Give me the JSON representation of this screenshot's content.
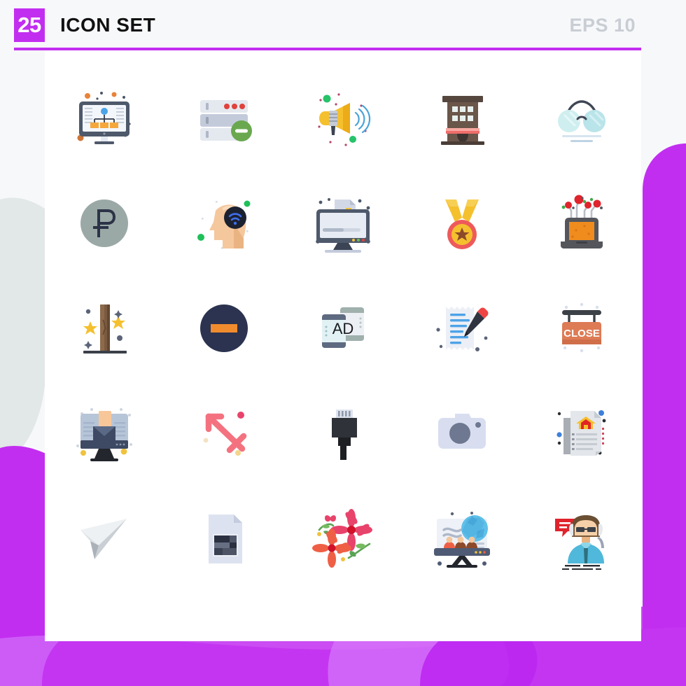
{
  "header": {
    "count": "25",
    "title": "ICON SET",
    "format": "EPS 10",
    "badge_color": "#c22ef0",
    "rule_color": "#c22ef0",
    "title_color": "#111111",
    "format_color": "#c9cdd4"
  },
  "background": {
    "page_color": "#f7f8fa",
    "card_color": "#ffffff",
    "blob_gray": "#e2e7e8",
    "blob_magenta": "#c22ef0",
    "blob_magenta_light": "#cd5cf7"
  },
  "grid": {
    "columns": 5,
    "rows": 5,
    "total_icons": 25
  },
  "icons": [
    {
      "index": 1,
      "name": "monitor-network-diagram-icon",
      "label": "Monitor Network Diagram"
    },
    {
      "index": 2,
      "name": "server-remove-icon",
      "label": "Server Remove"
    },
    {
      "index": 3,
      "name": "megaphone-icon",
      "label": "Megaphone Announcement"
    },
    {
      "index": 4,
      "name": "shop-building-icon",
      "label": "Shop Building"
    },
    {
      "index": 5,
      "name": "eyeglasses-icon",
      "label": "Eyeglasses"
    },
    {
      "index": 6,
      "name": "ruble-coin-icon",
      "label": "Ruble Coin"
    },
    {
      "index": 7,
      "name": "head-wifi-brain-icon",
      "label": "Head Wifi Brain"
    },
    {
      "index": 8,
      "name": "monitor-document-upload-icon",
      "label": "Monitor Document Upload"
    },
    {
      "index": 9,
      "name": "medal-star-icon",
      "label": "Medal Star Award"
    },
    {
      "index": 10,
      "name": "laptop-network-nodes-icon",
      "label": "Laptop Network Nodes"
    },
    {
      "index": 11,
      "name": "wooden-post-stars-icon",
      "label": "Wooden Post With Stars"
    },
    {
      "index": 12,
      "name": "circle-minus-remove-icon",
      "label": "Circle Minus Remove"
    },
    {
      "index": 13,
      "name": "mobile-ad-icon",
      "label": "Mobile Advertising"
    },
    {
      "index": 14,
      "name": "note-pencil-edit-icon",
      "label": "Note Pencil Edit"
    },
    {
      "index": 15,
      "name": "close-sign-icon",
      "label": "Close Sign",
      "sign_text": "CLOSE"
    },
    {
      "index": 16,
      "name": "monitor-email-icon",
      "label": "Monitor Email"
    },
    {
      "index": 17,
      "name": "crossing-arrows-icon",
      "label": "Crossing Arrows"
    },
    {
      "index": 18,
      "name": "ethernet-plug-icon",
      "label": "Ethernet Plug"
    },
    {
      "index": 19,
      "name": "camera-icon",
      "label": "Camera"
    },
    {
      "index": 20,
      "name": "property-document-icon",
      "label": "Property Document"
    },
    {
      "index": 21,
      "name": "paper-plane-send-icon",
      "label": "Paper Plane Send"
    },
    {
      "index": 22,
      "name": "image-file-icon",
      "label": "Image File"
    },
    {
      "index": 23,
      "name": "flowers-icon",
      "label": "Flowers"
    },
    {
      "index": 24,
      "name": "presentation-globe-icon",
      "label": "Presentation Globe Team"
    },
    {
      "index": 25,
      "name": "support-agent-icon",
      "label": "Support Agent"
    }
  ],
  "labels": {
    "mobile_ad_text": "AD",
    "close_sign_text": "CLOSE",
    "ruble_symbol": "₽"
  }
}
